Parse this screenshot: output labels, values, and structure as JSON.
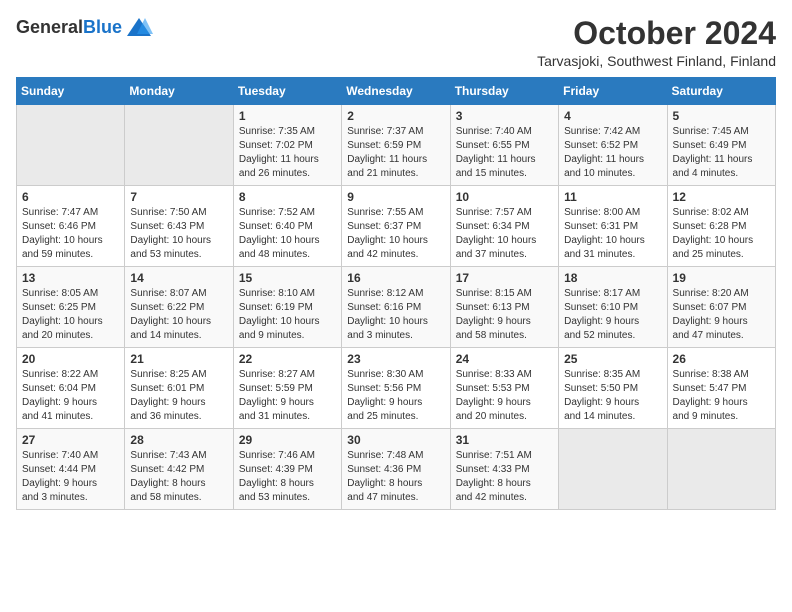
{
  "header": {
    "logo_general": "General",
    "logo_blue": "Blue",
    "month": "October 2024",
    "location": "Tarvasjoki, Southwest Finland, Finland"
  },
  "weekdays": [
    "Sunday",
    "Monday",
    "Tuesday",
    "Wednesday",
    "Thursday",
    "Friday",
    "Saturday"
  ],
  "weeks": [
    [
      {
        "day": "",
        "info": ""
      },
      {
        "day": "",
        "info": ""
      },
      {
        "day": "1",
        "info": "Sunrise: 7:35 AM\nSunset: 7:02 PM\nDaylight: 11 hours\nand 26 minutes."
      },
      {
        "day": "2",
        "info": "Sunrise: 7:37 AM\nSunset: 6:59 PM\nDaylight: 11 hours\nand 21 minutes."
      },
      {
        "day": "3",
        "info": "Sunrise: 7:40 AM\nSunset: 6:55 PM\nDaylight: 11 hours\nand 15 minutes."
      },
      {
        "day": "4",
        "info": "Sunrise: 7:42 AM\nSunset: 6:52 PM\nDaylight: 11 hours\nand 10 minutes."
      },
      {
        "day": "5",
        "info": "Sunrise: 7:45 AM\nSunset: 6:49 PM\nDaylight: 11 hours\nand 4 minutes."
      }
    ],
    [
      {
        "day": "6",
        "info": "Sunrise: 7:47 AM\nSunset: 6:46 PM\nDaylight: 10 hours\nand 59 minutes."
      },
      {
        "day": "7",
        "info": "Sunrise: 7:50 AM\nSunset: 6:43 PM\nDaylight: 10 hours\nand 53 minutes."
      },
      {
        "day": "8",
        "info": "Sunrise: 7:52 AM\nSunset: 6:40 PM\nDaylight: 10 hours\nand 48 minutes."
      },
      {
        "day": "9",
        "info": "Sunrise: 7:55 AM\nSunset: 6:37 PM\nDaylight: 10 hours\nand 42 minutes."
      },
      {
        "day": "10",
        "info": "Sunrise: 7:57 AM\nSunset: 6:34 PM\nDaylight: 10 hours\nand 37 minutes."
      },
      {
        "day": "11",
        "info": "Sunrise: 8:00 AM\nSunset: 6:31 PM\nDaylight: 10 hours\nand 31 minutes."
      },
      {
        "day": "12",
        "info": "Sunrise: 8:02 AM\nSunset: 6:28 PM\nDaylight: 10 hours\nand 25 minutes."
      }
    ],
    [
      {
        "day": "13",
        "info": "Sunrise: 8:05 AM\nSunset: 6:25 PM\nDaylight: 10 hours\nand 20 minutes."
      },
      {
        "day": "14",
        "info": "Sunrise: 8:07 AM\nSunset: 6:22 PM\nDaylight: 10 hours\nand 14 minutes."
      },
      {
        "day": "15",
        "info": "Sunrise: 8:10 AM\nSunset: 6:19 PM\nDaylight: 10 hours\nand 9 minutes."
      },
      {
        "day": "16",
        "info": "Sunrise: 8:12 AM\nSunset: 6:16 PM\nDaylight: 10 hours\nand 3 minutes."
      },
      {
        "day": "17",
        "info": "Sunrise: 8:15 AM\nSunset: 6:13 PM\nDaylight: 9 hours\nand 58 minutes."
      },
      {
        "day": "18",
        "info": "Sunrise: 8:17 AM\nSunset: 6:10 PM\nDaylight: 9 hours\nand 52 minutes."
      },
      {
        "day": "19",
        "info": "Sunrise: 8:20 AM\nSunset: 6:07 PM\nDaylight: 9 hours\nand 47 minutes."
      }
    ],
    [
      {
        "day": "20",
        "info": "Sunrise: 8:22 AM\nSunset: 6:04 PM\nDaylight: 9 hours\nand 41 minutes."
      },
      {
        "day": "21",
        "info": "Sunrise: 8:25 AM\nSunset: 6:01 PM\nDaylight: 9 hours\nand 36 minutes."
      },
      {
        "day": "22",
        "info": "Sunrise: 8:27 AM\nSunset: 5:59 PM\nDaylight: 9 hours\nand 31 minutes."
      },
      {
        "day": "23",
        "info": "Sunrise: 8:30 AM\nSunset: 5:56 PM\nDaylight: 9 hours\nand 25 minutes."
      },
      {
        "day": "24",
        "info": "Sunrise: 8:33 AM\nSunset: 5:53 PM\nDaylight: 9 hours\nand 20 minutes."
      },
      {
        "day": "25",
        "info": "Sunrise: 8:35 AM\nSunset: 5:50 PM\nDaylight: 9 hours\nand 14 minutes."
      },
      {
        "day": "26",
        "info": "Sunrise: 8:38 AM\nSunset: 5:47 PM\nDaylight: 9 hours\nand 9 minutes."
      }
    ],
    [
      {
        "day": "27",
        "info": "Sunrise: 7:40 AM\nSunset: 4:44 PM\nDaylight: 9 hours\nand 3 minutes."
      },
      {
        "day": "28",
        "info": "Sunrise: 7:43 AM\nSunset: 4:42 PM\nDaylight: 8 hours\nand 58 minutes."
      },
      {
        "day": "29",
        "info": "Sunrise: 7:46 AM\nSunset: 4:39 PM\nDaylight: 8 hours\nand 53 minutes."
      },
      {
        "day": "30",
        "info": "Sunrise: 7:48 AM\nSunset: 4:36 PM\nDaylight: 8 hours\nand 47 minutes."
      },
      {
        "day": "31",
        "info": "Sunrise: 7:51 AM\nSunset: 4:33 PM\nDaylight: 8 hours\nand 42 minutes."
      },
      {
        "day": "",
        "info": ""
      },
      {
        "day": "",
        "info": ""
      }
    ]
  ]
}
